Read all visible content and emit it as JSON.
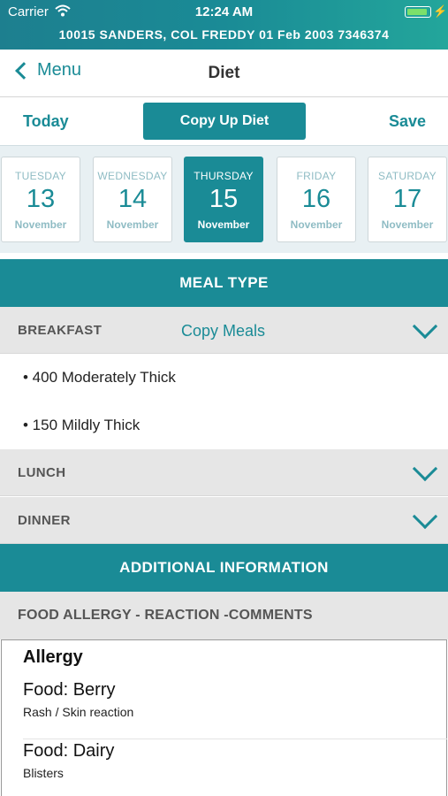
{
  "status": {
    "carrier": "Carrier",
    "time": "12:24 AM"
  },
  "patient_banner": "10015  SANDERS, COL FREDDY  01 Feb 2003  7346374",
  "nav": {
    "back_label": "Menu",
    "title": "Diet"
  },
  "actions": {
    "today": "Today",
    "copy_up": "Copy Up Diet",
    "save": "Save"
  },
  "dates": [
    {
      "dow": "TUESDAY",
      "day": "13",
      "month": "November",
      "selected": false
    },
    {
      "dow": "WEDNESDAY",
      "day": "14",
      "month": "November",
      "selected": false
    },
    {
      "dow": "THURSDAY",
      "day": "15",
      "month": "November",
      "selected": true
    },
    {
      "dow": "FRIDAY",
      "day": "16",
      "month": "November",
      "selected": false
    },
    {
      "dow": "SATURDAY",
      "day": "17",
      "month": "November",
      "selected": false
    }
  ],
  "meal_type_header": "MEAL TYPE",
  "meals": {
    "breakfast": {
      "label": "BREAKFAST",
      "copy": "Copy Meals",
      "items": [
        "• 400 Moderately Thick",
        "• 150 Mildly Thick"
      ]
    },
    "lunch": {
      "label": "LUNCH"
    },
    "dinner": {
      "label": "DINNER"
    }
  },
  "additional_header": "ADDITIONAL INFORMATION",
  "allergy_section": {
    "header": "FOOD ALLERGY - REACTION -COMMENTS",
    "title": "Allergy",
    "items": [
      {
        "food": "Food: Berry",
        "reaction": "Rash / Skin reaction"
      },
      {
        "food": "Food: Dairy",
        "reaction": "Blisters"
      }
    ]
  },
  "colors": {
    "accent": "#1a8b96",
    "selected_date": "#1a8b96",
    "row_bg": "#e6e6e6"
  }
}
